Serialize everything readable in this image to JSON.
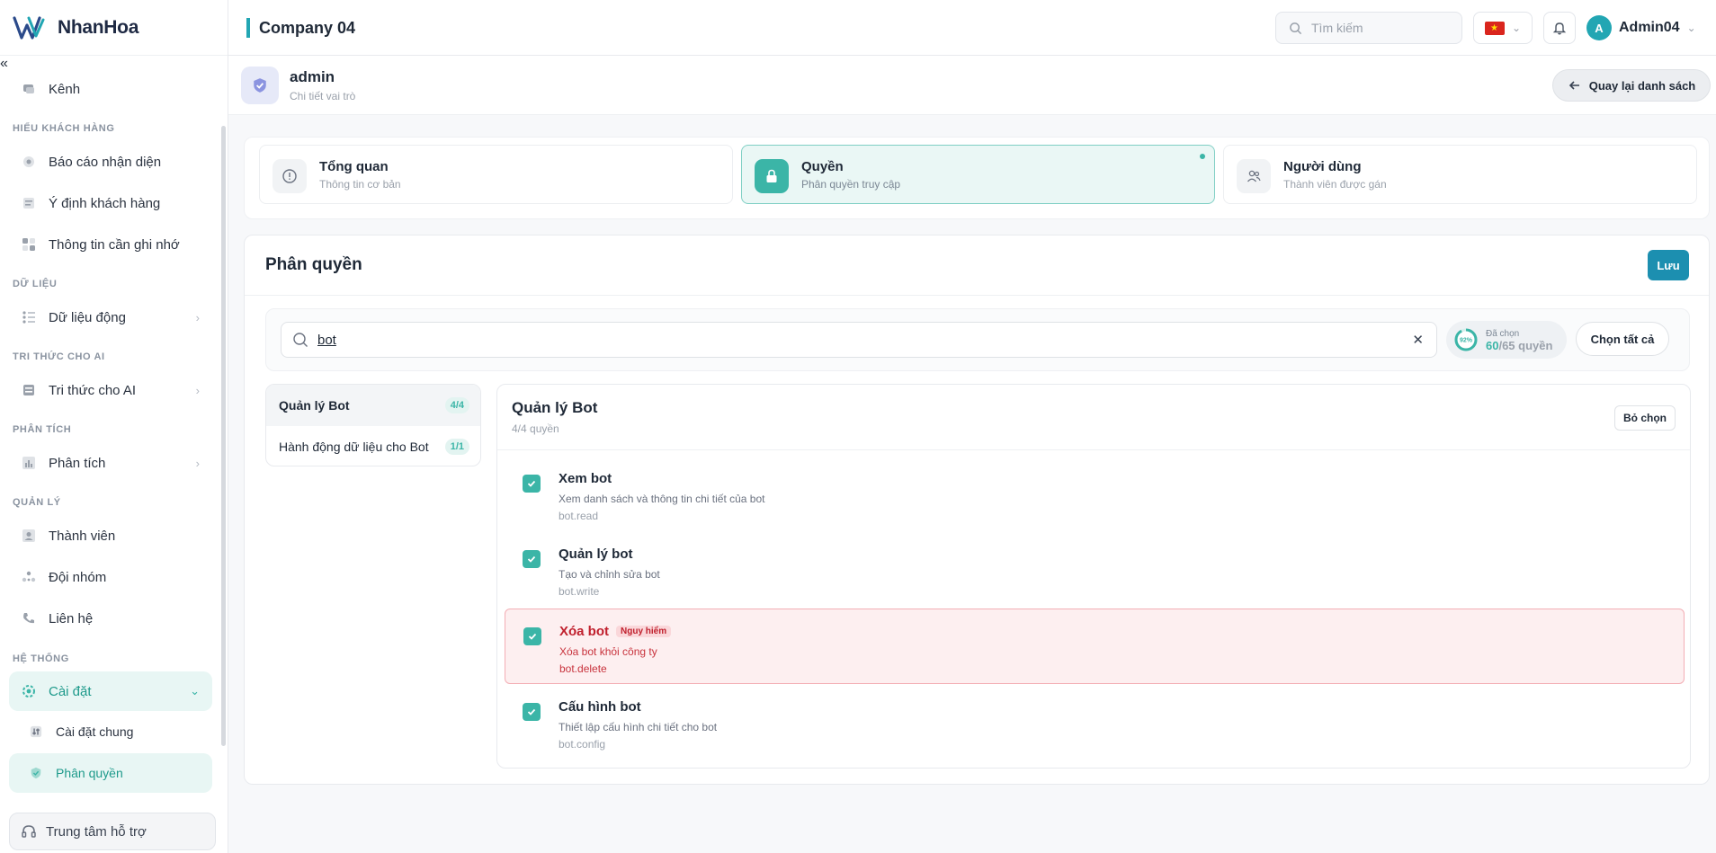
{
  "app": {
    "brand": "NhanHoa",
    "collapse_icon": "«"
  },
  "sidebar": {
    "items": [
      {
        "label": "Kênh",
        "icon": "channel-icon"
      },
      {
        "section": "HIỂU KHÁCH HÀNG"
      },
      {
        "label": "Báo cáo nhận diện",
        "icon": "report-icon"
      },
      {
        "label": "Ý định khách hàng",
        "icon": "intent-icon"
      },
      {
        "label": "Thông tin cần ghi nhớ",
        "icon": "memo-icon"
      },
      {
        "section": "DỮ LIỆU"
      },
      {
        "label": "Dữ liệu động",
        "icon": "data-icon"
      },
      {
        "section": "TRI THỨC CHO AI"
      },
      {
        "label": "Tri thức cho AI",
        "icon": "knowledge-icon"
      },
      {
        "section": "PHÂN TÍCH"
      },
      {
        "label": "Phân tích",
        "icon": "analytics-icon"
      },
      {
        "section": "QUẢN LÝ"
      },
      {
        "label": "Thành viên",
        "icon": "member-icon"
      },
      {
        "label": "Đội nhóm",
        "icon": "team-icon"
      },
      {
        "label": "Liên hệ",
        "icon": "contact-icon"
      },
      {
        "section": "HỆ THỐNG"
      },
      {
        "label": "Cài đặt",
        "icon": "settings-icon"
      },
      {
        "label": "Cài đặt chung",
        "icon": "sliders-icon"
      },
      {
        "label": "Phân quyền",
        "icon": "shield-icon"
      }
    ],
    "help": "Trung tâm hỗ trợ"
  },
  "header": {
    "company": "Company 04",
    "search_placeholder": "Tìm kiếm",
    "user_initial": "A",
    "user_name": "Admin04"
  },
  "role": {
    "name": "admin",
    "subtitle": "Chi tiết vai trò",
    "back_label": "Quay lại danh sách"
  },
  "tabs": [
    {
      "label": "Tổng quan",
      "sub": "Thông tin cơ bản",
      "icon": "info-icon"
    },
    {
      "label": "Quyền",
      "sub": "Phân quyền truy cập",
      "icon": "lock-icon",
      "active": true
    },
    {
      "label": "Người dùng",
      "sub": "Thành viên được gán",
      "icon": "users-icon"
    }
  ],
  "permissions": {
    "title": "Phân quyền",
    "save_label": "Lưu",
    "search_value": "bot",
    "selected_label": "Đã chọn",
    "selected_count": "60",
    "total_label": "/65 quyền",
    "percent_label": "92%",
    "percent_value": 0.92,
    "select_all_label": "Chọn tất cả",
    "groups": [
      {
        "label": "Quản lý Bot",
        "count": "4/4",
        "active": true
      },
      {
        "label": "Hành động dữ liệu cho Bot",
        "count": "1/1"
      }
    ],
    "detail": {
      "title": "Quản lý Bot",
      "sub": "4/4 quyền",
      "deselect_label": "Bỏ chọn",
      "items": [
        {
          "name": "Xem bot",
          "desc": "Xem danh sách và thông tin chi tiết của bot",
          "key": "bot.read",
          "checked": true
        },
        {
          "name": "Quản lý bot",
          "desc": "Tạo và chỉnh sửa bot",
          "key": "bot.write",
          "checked": true
        },
        {
          "name": "Xóa bot",
          "desc": "Xóa bot khỏi công ty",
          "key": "bot.delete",
          "checked": true,
          "danger_label": "Nguy hiểm"
        },
        {
          "name": "Cấu hình bot",
          "desc": "Thiết lập cấu hình chi tiết cho bot",
          "key": "bot.config",
          "checked": true
        }
      ]
    }
  },
  "colors": {
    "accent": "#3bb5a7",
    "primary": "#1c8fb0",
    "danger": "#c0202d"
  }
}
